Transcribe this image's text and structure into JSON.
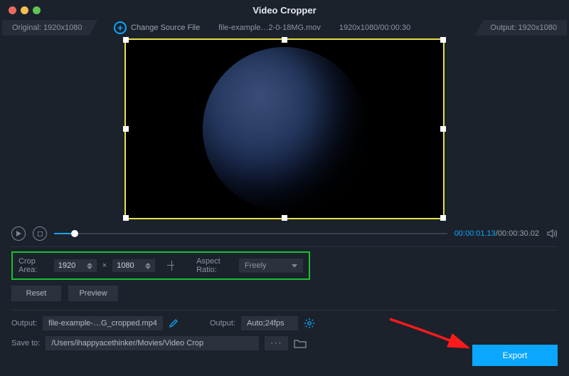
{
  "titlebar": {
    "title": "Video Cropper"
  },
  "infostrip": {
    "original_label": "Original: 1920x1080",
    "change_source": "Change Source File",
    "filename": "file-example…2-0-18MG.mov",
    "src_dimensions_duration": "1920x1080/00:00:30",
    "output_label": "Output: 1920x1080"
  },
  "playback": {
    "current": "00:00:01.13",
    "total": "00:00:30.02"
  },
  "crop": {
    "area_label": "Crop Area:",
    "width": "1920",
    "times": "×",
    "height": "1080",
    "ratio_label": "Aspect Ratio:",
    "ratio_value": "Freely"
  },
  "buttons": {
    "reset": "Reset",
    "preview": "Preview",
    "export": "Export"
  },
  "output": {
    "label1": "Output:",
    "filename": "file-example-…G_cropped.mp4",
    "label2": "Output:",
    "format": "Auto;24fps",
    "saveto_label": "Save to:",
    "saveto_path": "/Users/ihappyacethinker/Movies/Video Crop"
  }
}
